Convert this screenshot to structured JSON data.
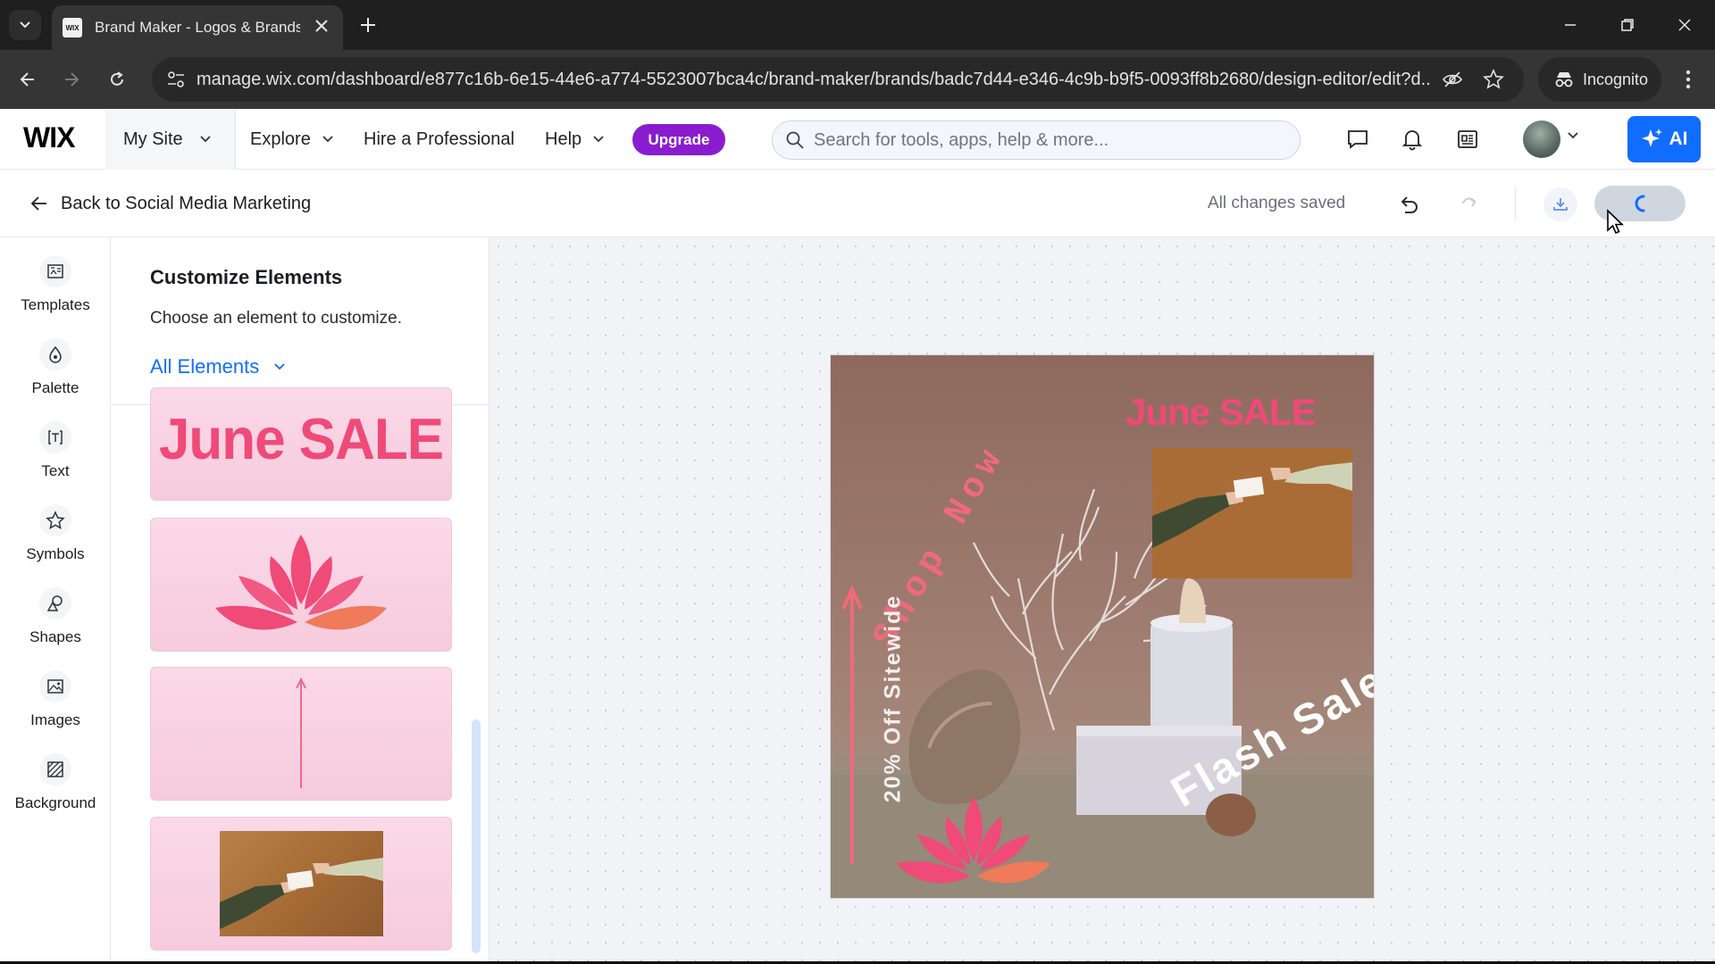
{
  "browser": {
    "tab_title": "Brand Maker - Logos & Brands",
    "favicon_text": "WIX",
    "url": "manage.wix.com/dashboard/e877c16b-6e15-44e6-a774-5523007bca4c/brand-maker/brands/badc7d44-e346-4c9b-b9f5-0093ff8b2680/design-editor/edit?d...",
    "incognito_label": "Incognito"
  },
  "wix_header": {
    "logo": "WIX",
    "my_site": "My Site",
    "explore": "Explore",
    "hire": "Hire a Professional",
    "help": "Help",
    "upgrade": "Upgrade",
    "search_placeholder": "Search for tools, apps, help & more...",
    "ai_label": "AI"
  },
  "editor_header": {
    "back_label": "Back to Social Media Marketing",
    "status": "All changes saved"
  },
  "rail": {
    "items": [
      {
        "label": "Templates",
        "icon": "templates-icon"
      },
      {
        "label": "Palette",
        "icon": "palette-icon"
      },
      {
        "label": "Text",
        "icon": "text-icon"
      },
      {
        "label": "Symbols",
        "icon": "star-icon"
      },
      {
        "label": "Shapes",
        "icon": "shapes-icon"
      },
      {
        "label": "Images",
        "icon": "image-icon"
      },
      {
        "label": "Background",
        "icon": "background-icon"
      }
    ]
  },
  "panel": {
    "title": "Customize Elements",
    "subtitle": "Choose an element to customize.",
    "filter_label": "All Elements",
    "cards": [
      {
        "kind": "text",
        "text": "June SALE"
      },
      {
        "kind": "symbol",
        "name": "lotus"
      },
      {
        "kind": "shape",
        "name": "arrow"
      },
      {
        "kind": "image",
        "name": "hands-business-card"
      }
    ]
  },
  "artboard": {
    "headline": "June SALE",
    "curved_text": "Shop Now",
    "vertical_text": "20% Off Sitewide",
    "flash_text": "Flash Sale"
  },
  "colors": {
    "accent_pink": "#ef4a78",
    "wix_blue": "#116dff",
    "upgrade_purple": "#8a1ccf"
  }
}
